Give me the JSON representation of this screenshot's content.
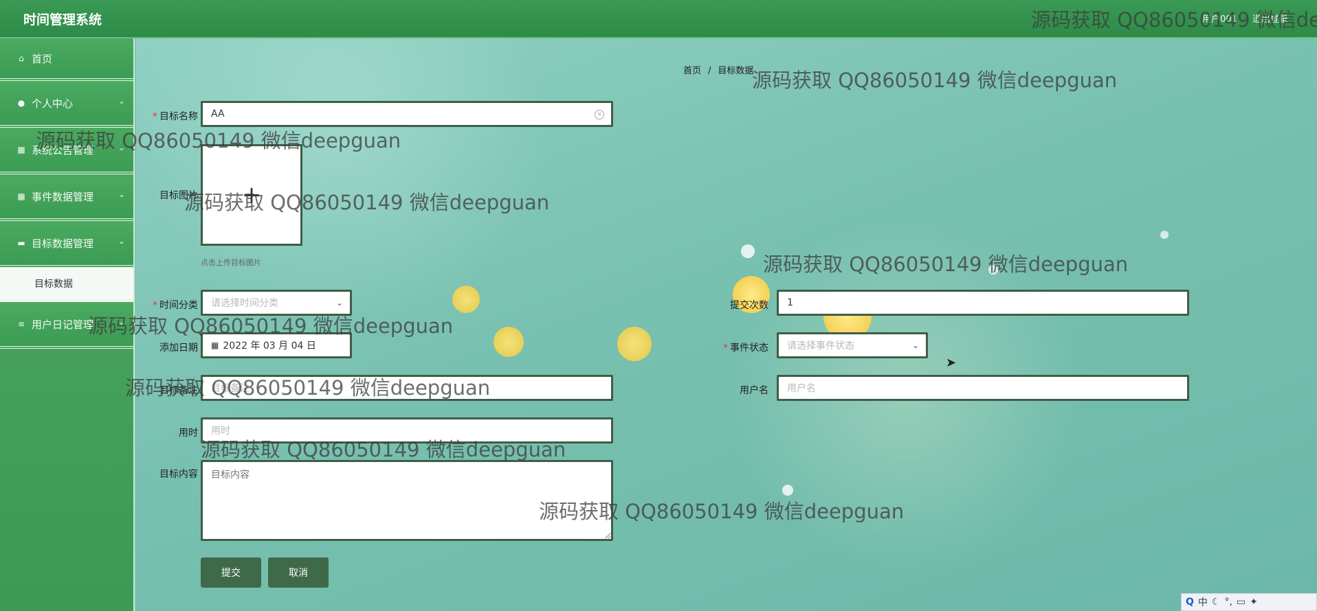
{
  "header": {
    "title": "时间管理系统",
    "user_label": "用户001",
    "logout_label": "退出登录"
  },
  "sidebar": {
    "items": [
      {
        "label": "首页",
        "icon": "home-icon"
      },
      {
        "label": "个人中心",
        "icon": "user-icon"
      },
      {
        "label": "系统公告管理",
        "icon": "grid-icon"
      },
      {
        "label": "事件数据管理",
        "icon": "grid-icon"
      },
      {
        "label": "目标数据管理",
        "icon": "cup-icon"
      },
      {
        "label": "用户日记管理",
        "icon": "menu-icon"
      }
    ],
    "sub_item": "目标数据"
  },
  "breadcrumb": {
    "home": "首页",
    "separator": "/",
    "current": "目标数据"
  },
  "form": {
    "target_name": {
      "label": "目标名称",
      "value": "AA"
    },
    "target_image": {
      "label": "目标图片",
      "hint": "点击上传目标图片"
    },
    "time_category": {
      "label": "时间分类",
      "placeholder": "请选择时间分类"
    },
    "submit_count": {
      "label": "提交次数",
      "value": "1"
    },
    "add_date": {
      "label": "添加日期",
      "value": "2022 年 03 月 04 日"
    },
    "event_status": {
      "label": "事件状态",
      "placeholder": "请选择事件状态"
    },
    "target_note": {
      "label": "目标备注",
      "placeholder": "目标备注"
    },
    "username": {
      "label": "用户名",
      "placeholder": "用户名"
    },
    "time_used": {
      "label": "用时",
      "placeholder": "用时"
    },
    "target_content": {
      "label": "目标内容",
      "placeholder": "目标内容"
    }
  },
  "buttons": {
    "submit": "提交",
    "cancel": "取消"
  },
  "watermark_text": "源码获取 QQ86050149 微信deepguan",
  "ime": {
    "text": "中"
  },
  "colors": {
    "topbar": "#2e8a48",
    "sidebar": "#3b9a55",
    "button": "#3f6a4a",
    "required": "#ee3333"
  }
}
